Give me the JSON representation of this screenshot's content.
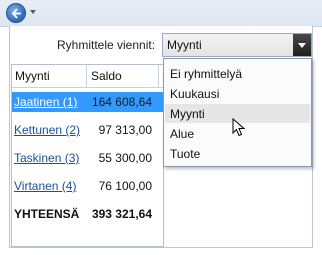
{
  "toolbar": {
    "back_icon": "back-arrow-icon",
    "menu_icon": "chevron-down-icon",
    "accent": "#2f67b5"
  },
  "group_by": {
    "label": "Ryhmittele viennit:",
    "selected": "Myynti",
    "options": [
      "Ei ryhmittelyä",
      "Kuukausi",
      "Myynti",
      "Alue",
      "Tuote"
    ],
    "hovered": "Myynti"
  },
  "table": {
    "columns": [
      "Myynti",
      "Saldo"
    ],
    "rows": [
      {
        "name": "Jaatinen (1)",
        "amount": "164 608,64",
        "selected": true
      },
      {
        "name": "Kettunen (2)",
        "amount": "97 313,00"
      },
      {
        "name": "Taskinen (3)",
        "amount": "55 300,00"
      },
      {
        "name": "Virtanen (4)",
        "amount": "76 100,00"
      }
    ],
    "total": {
      "label": "YHTEENSÄ",
      "amount": "393 321,64"
    },
    "selection_color": "#3399ff"
  }
}
